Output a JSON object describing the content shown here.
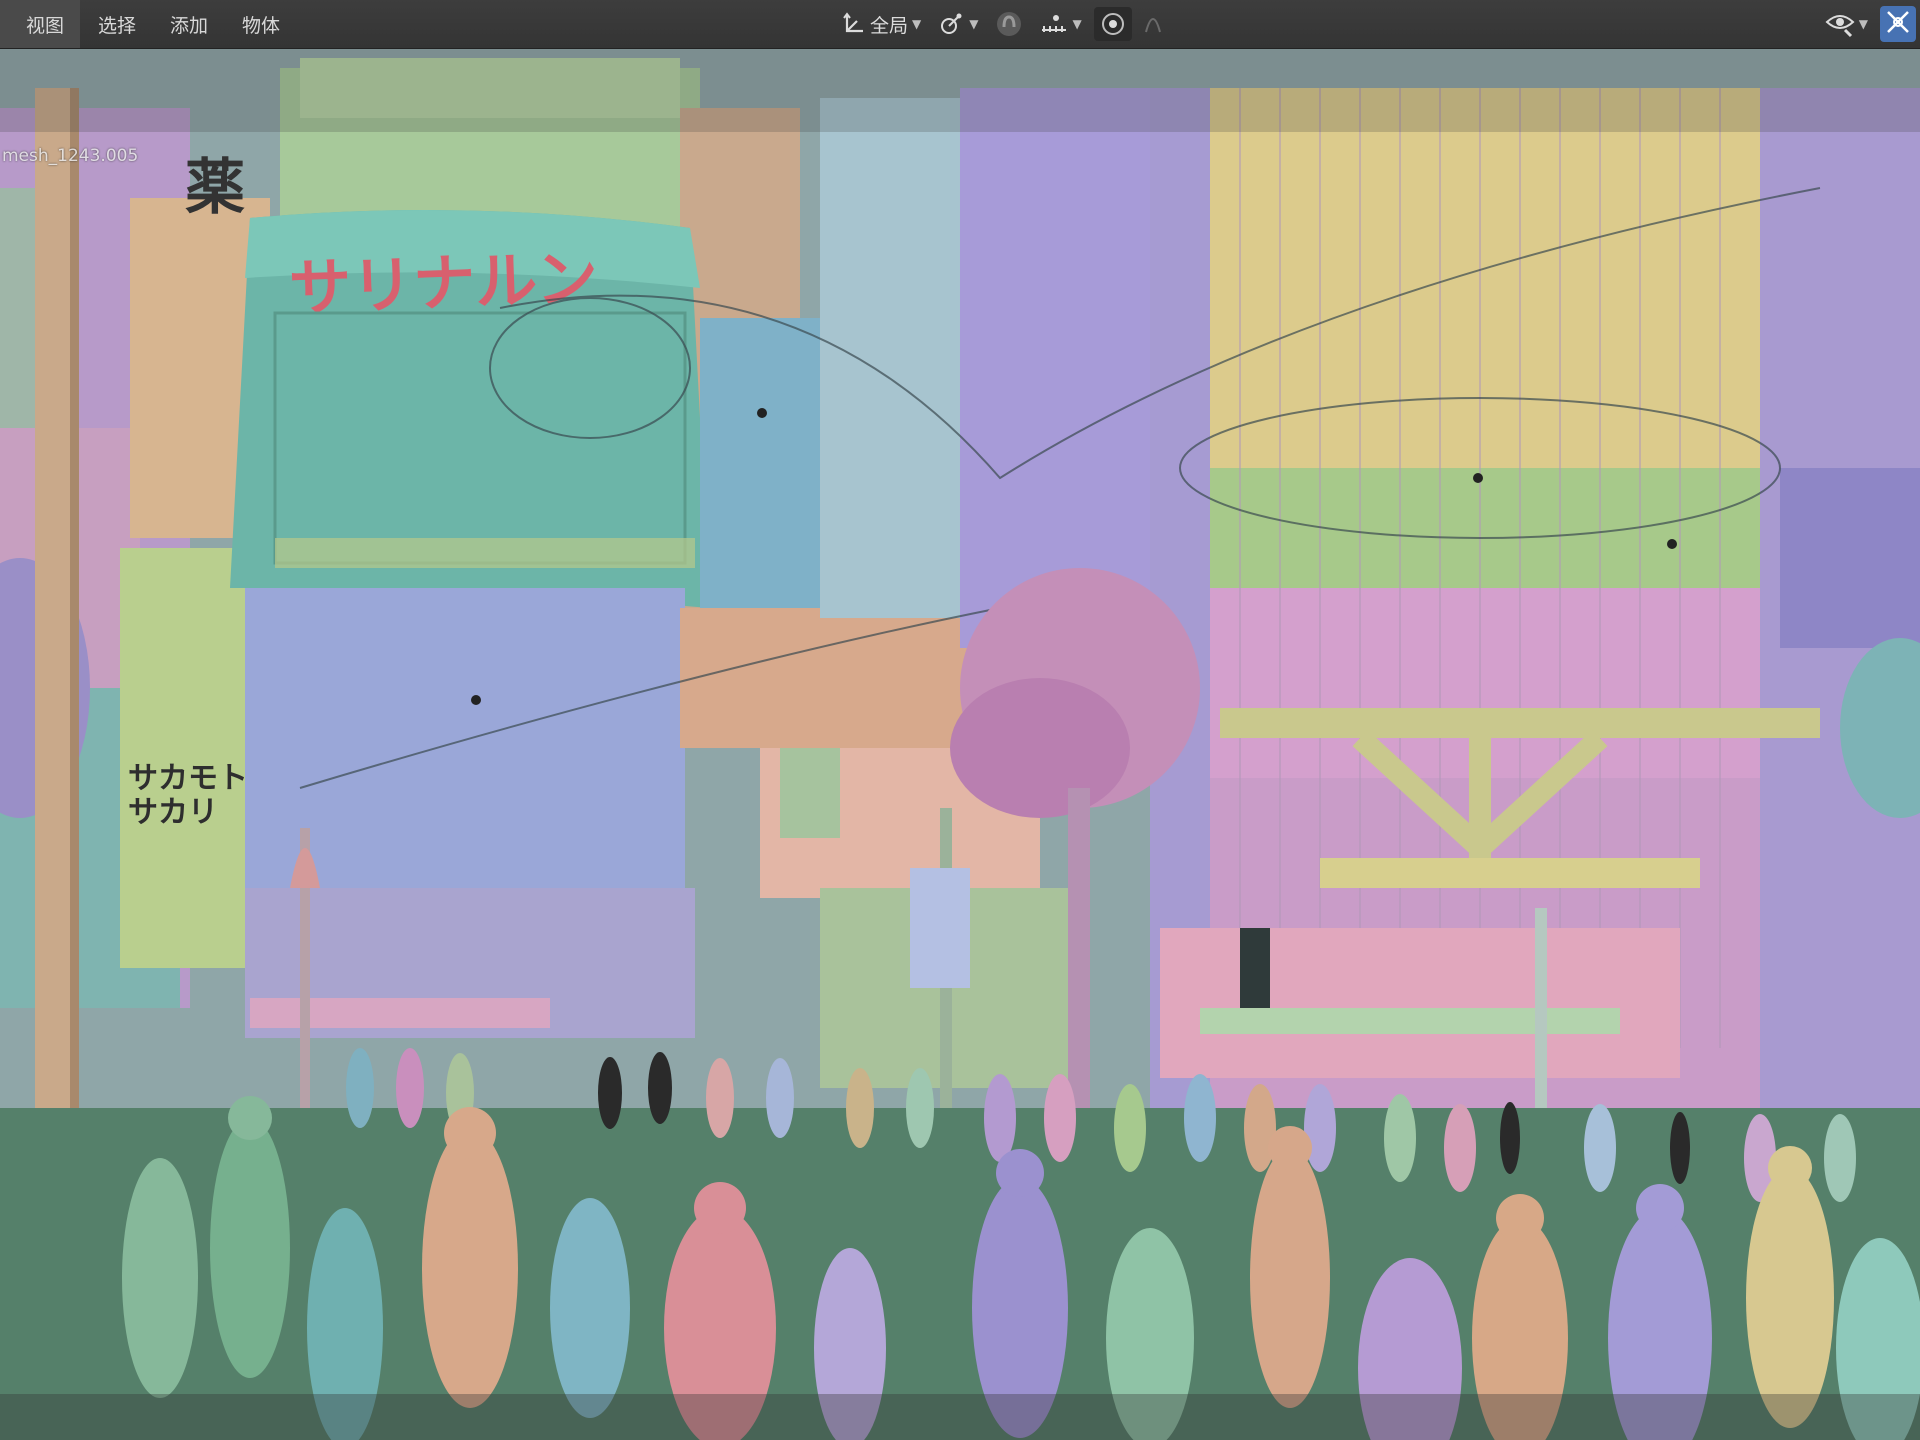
{
  "header": {
    "menu": [
      "视图",
      "选择",
      "添加",
      "物体"
    ],
    "transform_orientation": "全局"
  },
  "viewport": {
    "object_label": "mesh_1243.005",
    "signs": {
      "building_sign": "サリナルン",
      "kanji_sign": "薬",
      "vertical_sign": "サカモト\nサカリ"
    }
  },
  "colors": {
    "header_bg": "#3d3d3d",
    "accent_blue": "#4772b3",
    "building_pink": "#c98fc4",
    "building_yellow": "#d9cc8a",
    "building_purple": "#9b8fd0",
    "building_teal": "#6fb3a7",
    "ground_green": "#55806a"
  },
  "icons": [
    "transform-orientation-icon",
    "pivot-icon",
    "snap-icon",
    "snap-increment-icon",
    "proportional-edit-icon",
    "visibility-icon",
    "navigation-gizmo-icon"
  ]
}
